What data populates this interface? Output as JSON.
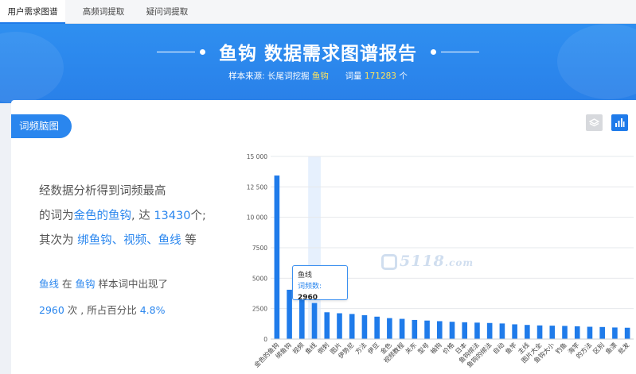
{
  "tabs": [
    {
      "label": "用户需求图谱",
      "active": true
    },
    {
      "label": "高频词提取",
      "active": false
    },
    {
      "label": "疑问词提取",
      "active": false
    }
  ],
  "banner": {
    "title": "鱼钩 数据需求图谱报告",
    "source_label": "样本来源:",
    "source_value": "长尾词挖掘",
    "keyword": "鱼钩",
    "volume_label": "词量",
    "volume_value": "171283",
    "volume_unit": "个"
  },
  "section": {
    "tag": "词频脑图",
    "tools": [
      {
        "icon": "layers-icon"
      },
      {
        "icon": "bar-chart-icon"
      }
    ]
  },
  "summary": {
    "p1_a": "经数据分析得到词频最高",
    "p1_b": "的词为",
    "top_word": "金色的鱼钩",
    "p1_c": ", 达",
    "top_count": "13430",
    "p1_d": "个;",
    "p1_e": "其次为",
    "next_words": "绑鱼钩、视频、鱼线",
    "p1_f": "等",
    "p2_word": "鱼线",
    "p2_a": "在",
    "p2_keyword": "鱼钩",
    "p2_b": "样本词中出现了",
    "p2_count": "2960",
    "p2_c": "次 , 所占百分比",
    "p2_pct": "4.8%"
  },
  "tooltip": {
    "title": "鱼线",
    "label": "词频数:",
    "value": "2960"
  },
  "watermark": {
    "text": "5118",
    "suffix": ".com"
  },
  "chart_data": {
    "type": "bar",
    "categories": [
      "金色的鱼钩",
      "绑鱼钩",
      "视频",
      "鱼线",
      "倒刺",
      "图片",
      "伊势尼",
      "方法",
      "伊豆",
      "金色",
      "视频教程",
      "关东",
      "型号",
      "袖钩",
      "价格",
      "日本",
      "鱼钩绑法",
      "鱼钩的绑法",
      "自动",
      "鱼竿",
      "主线",
      "图片大全",
      "鱼钩大小",
      "钓鱼",
      "海竿",
      "的方法",
      "区别",
      "鱼漂",
      "批发"
    ],
    "values": [
      13430,
      4050,
      3950,
      2960,
      2200,
      2120,
      2060,
      1960,
      1840,
      1720,
      1660,
      1570,
      1520,
      1470,
      1420,
      1380,
      1350,
      1320,
      1280,
      1210,
      1160,
      1120,
      1100,
      1080,
      1050,
      1010,
      990,
      950,
      930
    ],
    "highlight_index": 3,
    "yticks": [
      "0",
      "2500",
      "5000",
      "7500",
      "10 000",
      "12 500",
      "15 000"
    ],
    "ylim": [
      0,
      15000
    ],
    "bar_color": "#1f7bea",
    "highlight_band_color": "#e6f0fd",
    "grid": true
  }
}
